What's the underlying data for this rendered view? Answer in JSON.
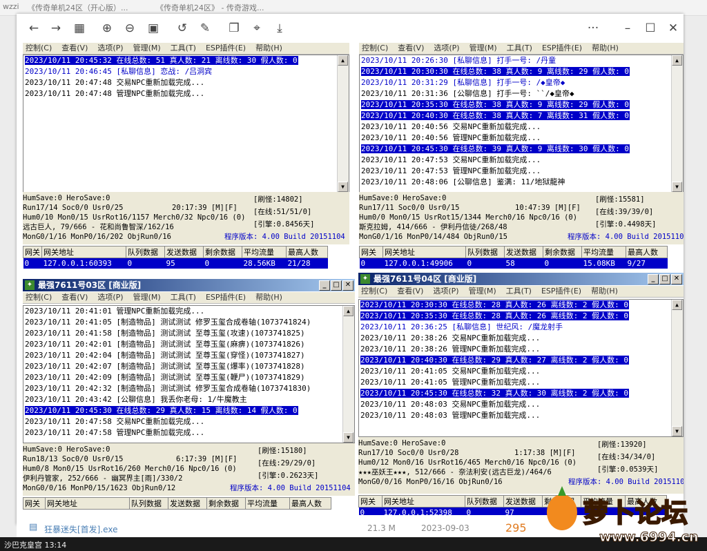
{
  "top_strip": {
    "left_fragment": "wzzi",
    "title_a": "《传奇单机24区（开心版）...",
    "title_b": "《传奇单机24区》 - 传奇游戏..."
  },
  "viewer": {
    "toolbar": {
      "icons": [
        "back-arrow-icon",
        "forward-arrow-icon",
        "grid-icon",
        "zoom-in-icon",
        "zoom-out-icon",
        "fit-icon",
        "rotate-icon",
        "edit-icon",
        "copy-icon",
        "crop-icon",
        "download-icon"
      ],
      "more": "···",
      "min": "–",
      "max": "☐",
      "close": "✕"
    },
    "footer": {
      "filename": "狂暴迷失[首发].exe",
      "size": "21.3 M",
      "date": "2023-09-03",
      "count": "295"
    }
  },
  "taskbar": {
    "text": "沙巴克皇宫 13:14"
  },
  "watermark": {
    "text": "萝卜论坛",
    "url": "www.6994.cn"
  },
  "menu": [
    "控制(C)",
    "查看(V)",
    "选项(P)",
    "管理(M)",
    "工具(T)",
    "ESP插件(E)",
    "帮助(H)"
  ],
  "grid_headers": [
    "网关",
    "网关地址",
    "队列数据",
    "发送数据",
    "剩余数据",
    "平均流量",
    "最高人数"
  ],
  "panels": [
    {
      "title": "",
      "log": [
        {
          "t": "2023/10/11 20:45:32 在线总数: 51 真人数: 21 离线数: 30 假人数: 0",
          "hl": true
        },
        {
          "t": "2023/10/11 20:46:45 [私聊信息] 恋战: /吕洞宾",
          "pv": true
        },
        {
          "t": "2023/10/11 20:47:48 交易NPC重新加载完成..."
        },
        {
          "t": "2023/10/11 20:47:48 管理NPC重新加载完成..."
        }
      ],
      "stat": {
        "l1": "HumSave:0 HeroSave:0",
        "l2": "Run17/14 Soc0/0 Usr0/25",
        "time": "20:17:39 [M][F]",
        "l3": "Hum0/10 Mon0/15 UsrRot16/1157 Merch0/32 Npc0/16 (0)",
        "l4": "远古巨人, 79/666 - 花和尚鲁智深/162/16",
        "l5": "MonG0/1/16 MonP0/16/202 ObjRun0/16",
        "r1": "[刷怪:14802]",
        "r2": "[在线:51/51/0]",
        "r3": "[引擎:0.8456天]",
        "ver": "程序版本: 4.00 Build 20151104"
      },
      "grid": [
        [
          "0",
          "127.0.0.1:60393",
          "0",
          "95",
          "0",
          "28.56KB",
          "21/28"
        ]
      ]
    },
    {
      "title": "",
      "log": [
        {
          "t": "2023/10/11 20:26:30 [私聊信息] 打手一号: /丹童",
          "pv": true
        },
        {
          "t": "2023/10/11 20:30:30 在线总数: 38 真人数: 9 离线数: 29 假人数: 0",
          "hl": true
        },
        {
          "t": "2023/10/11 20:31:29 [私聊信息] 打手一号: /◆皇帝◆",
          "pv": true
        },
        {
          "t": "2023/10/11 20:31:36 [公聊信息] 打手一号: ``/◆皇帝◆"
        },
        {
          "t": "2023/10/11 20:35:30 在线总数: 38 真人数: 9 离线数: 29 假人数: 0",
          "hl": true
        },
        {
          "t": "2023/10/11 20:40:30 在线总数: 38 真人数: 7 离线数: 31 假人数: 0",
          "hl": true
        },
        {
          "t": "2023/10/11 20:40:56 交易NPC重新加载完成..."
        },
        {
          "t": "2023/10/11 20:40:56 管理NPC重新加载完成..."
        },
        {
          "t": "2023/10/11 20:45:30 在线总数: 39 真人数: 9 离线数: 30 假人数: 0",
          "hl": true
        },
        {
          "t": "2023/10/11 20:47:53 交易NPC重新加载完成..."
        },
        {
          "t": "2023/10/11 20:47:53 管理NPC重新加载完成..."
        },
        {
          "t": "2023/10/11 20:48:06 [公聊信息] 鉴满: 11/地狱龍神"
        }
      ],
      "stat": {
        "l1": "HumSave:0 HeroSave:0",
        "l2": "Run17/11 Soc0/0 Usr0/15",
        "time": "10:47:39 [M][F]",
        "l3": "Hum0/0 Mon0/15 UsrRot15/1344 Merch0/16 Npc0/16 (0)",
        "l4": "斯克拉姆, 414/666 - 伊利丹信徒/268/48",
        "l5": "MonG0/1/16 MonP0/14/484 ObjRun0/15",
        "r1": "[刷怪:15581]",
        "r2": "[在线:39/39/0]",
        "r3": "[引擎:0.4498天]",
        "ver": "程序版本: 4.00 Build 20151104"
      },
      "grid": [
        [
          "0",
          "127.0.0.1:49906",
          "0",
          "58",
          "0",
          "15.08KB",
          "9/27"
        ]
      ]
    },
    {
      "title": "最强7611号03区 [商业版]",
      "log": [
        {
          "t": "2023/10/11 20:41:01 管理NPC重新加载完成..."
        },
        {
          "t": "2023/10/11 20:41:05 [制造物品] 测试测试 修罗玉玺合成卷轴(1073741824)"
        },
        {
          "t": "2023/10/11 20:41:58 [制造物品] 测试测试 至尊玉玺(攻速)(1073741825)"
        },
        {
          "t": "2023/10/11 20:42:01 [制造物品] 测试测试 至尊玉玺(麻痹)(1073741826)"
        },
        {
          "t": "2023/10/11 20:42:04 [制造物品] 测试测试 至尊玉玺(穿怪)(1073741827)"
        },
        {
          "t": "2023/10/11 20:42:07 [制造物品] 测试测试 至尊玉玺(爆率)(1073741828)"
        },
        {
          "t": "2023/10/11 20:42:09 [制造物品] 测试测试 至尊玉玺(鞭尸)(1073741829)"
        },
        {
          "t": "2023/10/11 20:42:32 [制造物品] 测试测试 修罗玉玺合成卷轴(1073741830)"
        },
        {
          "t": "2023/10/11 20:43:42 [公聊信息] 我丢你老母: 1/牛魔教主"
        },
        {
          "t": "2023/10/11 20:45:30 在线总数: 29 真人数: 15 离线数: 14 假人数: 0",
          "hl": true
        },
        {
          "t": "2023/10/11 20:47:58 交易NPC重新加载完成..."
        },
        {
          "t": "2023/10/11 20:47:58 管理NPC重新加载完成..."
        }
      ],
      "stat": {
        "l1": "HumSave:0 HeroSave:0",
        "l2": "Run18/13 Soc0/0 Usr0/15",
        "time": "6:17:39 [M][F]",
        "l3": "Hum0/8 Mon0/15 UsrRot16/260 Merch0/16 Npc0/16 (0)",
        "l4": "伊利丹管家, 252/666 - 幽冥界主[雨]/330/2",
        "l5": "MonG0/0/16 MonP0/15/1623 ObjRun0/12",
        "r1": "[刷怪:15180]",
        "r2": "[在线:29/29/0]",
        "r3": "[引擎:0.2623天]",
        "ver": "程序版本: 4.00 Build 20151104"
      },
      "grid": []
    },
    {
      "title": "最强7611号04区 [商业版]",
      "log": [
        {
          "t": "2023/10/11 20:30:30 在线总数: 28 真人数: 26 离线数: 2 假人数: 0",
          "hl": true
        },
        {
          "t": "2023/10/11 20:35:30 在线总数: 28 真人数: 26 离线数: 2 假人数: 0",
          "hl": true
        },
        {
          "t": "2023/10/11 20:36:25 [私聊信息] 世纪风: /魔龙射手",
          "pv": true
        },
        {
          "t": "2023/10/11 20:38:26 交易NPC重新加载完成..."
        },
        {
          "t": "2023/10/11 20:38:26 管理NPC重新加载完成..."
        },
        {
          "t": "2023/10/11 20:40:30 在线总数: 29 真人数: 27 离线数: 2 假人数: 0",
          "hl": true
        },
        {
          "t": "2023/10/11 20:41:05 交易NPC重新加载完成..."
        },
        {
          "t": "2023/10/11 20:41:05 管理NPC重新加载完成..."
        },
        {
          "t": "2023/10/11 20:45:30 在线总数: 32 真人数: 30 离线数: 2 假人数: 0",
          "hl": true
        },
        {
          "t": "2023/10/11 20:48:03 交易NPC重新加载完成..."
        },
        {
          "t": "2023/10/11 20:48:03 管理NPC重新加载完成..."
        }
      ],
      "stat": {
        "l1": "HumSave:0 HeroSave:0",
        "l2": "Run17/10 Soc0/0 Usr0/28",
        "time": "1:17:38 [M][F]",
        "l3": "Hum0/12 Mon0/16 UsrRot16/465 Merch0/16 Npc0/16 (0)",
        "l4": "★★★巫妖王★★★, 512/666 - 奈法利安(远古巨龙)/464/6",
        "l5": "MonG0/0/16 MonP0/16/16 ObjRun0/16",
        "r1": "[刷怪:13920]",
        "r2": "[在线:34/34/0]",
        "r3": "[引擎:0.0539天]",
        "ver": "程序版本: 4.00 Build 20151104"
      },
      "grid": [
        [
          "0",
          "127.0.0.1:52398",
          "0",
          "97",
          "",
          "",
          ""
        ]
      ]
    }
  ]
}
